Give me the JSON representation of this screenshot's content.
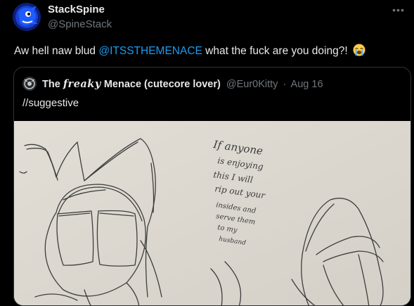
{
  "post": {
    "author": {
      "display_name": "StackSpine",
      "handle": "@SpineStack"
    },
    "more_icon": "more-horizontal-icon",
    "text": {
      "before": "Aw hell naw blud ",
      "mention": "@ITSSTHEMENACE",
      "after": " what the fuck are you doing?! ",
      "emoji": "loudly-crying-face-emoji"
    },
    "quote": {
      "name_prefix": "The ",
      "name_fancy": "𝒇𝒓𝒆𝒂𝒌𝒚",
      "name_suffix": " Menace (cutecore lover)",
      "handle": "@Eur0Kitty",
      "separator": "·",
      "date": "Aug 16",
      "text": "//suggestive",
      "image": {
        "description_icon": "pencil-sketch-image",
        "handwriting": [
          "If anyone",
          "is enjoying",
          "this I will",
          "rip out your",
          "insides and",
          "serve them",
          "to my",
          "husband"
        ]
      }
    }
  },
  "colors": {
    "background": "#000000",
    "text": "#e7e9ea",
    "muted": "#71767b",
    "link": "#1d9bf0",
    "border": "#2f3336",
    "paper": "#ddd9d0"
  }
}
